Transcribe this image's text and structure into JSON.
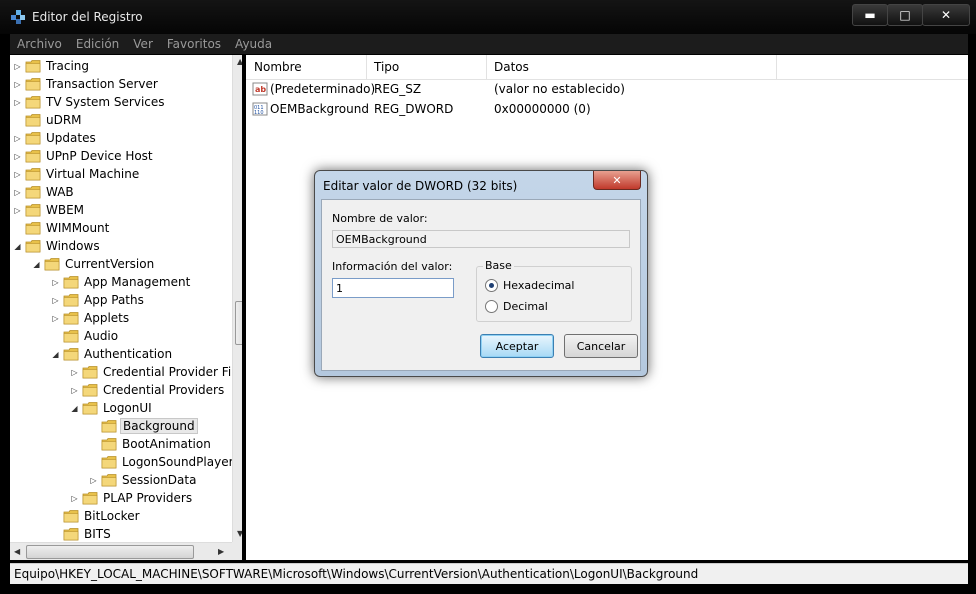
{
  "window": {
    "title": "Editor del Registro"
  },
  "menu": [
    "Archivo",
    "Edición",
    "Ver",
    "Favoritos",
    "Ayuda"
  ],
  "tree": [
    {
      "label": "Tracing",
      "level": 0,
      "exp": "closed"
    },
    {
      "label": "Transaction Server",
      "level": 0,
      "exp": "closed"
    },
    {
      "label": "TV System Services",
      "level": 0,
      "exp": "closed"
    },
    {
      "label": "uDRM",
      "level": 0,
      "exp": "none"
    },
    {
      "label": "Updates",
      "level": 0,
      "exp": "closed"
    },
    {
      "label": "UPnP Device Host",
      "level": 0,
      "exp": "closed"
    },
    {
      "label": "Virtual Machine",
      "level": 0,
      "exp": "closed"
    },
    {
      "label": "WAB",
      "level": 0,
      "exp": "closed"
    },
    {
      "label": "WBEM",
      "level": 0,
      "exp": "closed"
    },
    {
      "label": "WIMMount",
      "level": 0,
      "exp": "none"
    },
    {
      "label": "Windows",
      "level": 0,
      "exp": "open"
    },
    {
      "label": "CurrentVersion",
      "level": 1,
      "exp": "open"
    },
    {
      "label": "App Management",
      "level": 2,
      "exp": "closed"
    },
    {
      "label": "App Paths",
      "level": 2,
      "exp": "closed"
    },
    {
      "label": "Applets",
      "level": 2,
      "exp": "closed"
    },
    {
      "label": "Audio",
      "level": 2,
      "exp": "none"
    },
    {
      "label": "Authentication",
      "level": 2,
      "exp": "open"
    },
    {
      "label": "Credential Provider Fil",
      "level": 3,
      "exp": "closed"
    },
    {
      "label": "Credential Providers",
      "level": 3,
      "exp": "closed"
    },
    {
      "label": "LogonUI",
      "level": 3,
      "exp": "open"
    },
    {
      "label": "Background",
      "level": 4,
      "exp": "none",
      "selected": true
    },
    {
      "label": "BootAnimation",
      "level": 4,
      "exp": "none"
    },
    {
      "label": "LogonSoundPlayer",
      "level": 4,
      "exp": "none"
    },
    {
      "label": "SessionData",
      "level": 4,
      "exp": "closed"
    },
    {
      "label": "PLAP Providers",
      "level": 3,
      "exp": "closed"
    },
    {
      "label": "BitLocker",
      "level": 2,
      "exp": "none"
    },
    {
      "label": "BITS",
      "level": 2,
      "exp": "none"
    }
  ],
  "list": {
    "columns": [
      "Nombre",
      "Tipo",
      "Datos"
    ],
    "rows": [
      {
        "icon": "string-value-icon",
        "name": "(Predeterminado)",
        "type": "REG_SZ",
        "data": "(valor no establecido)"
      },
      {
        "icon": "binary-value-icon",
        "name": "OEMBackground",
        "type": "REG_DWORD",
        "data": "0x00000000 (0)"
      }
    ]
  },
  "status": "Equipo\\HKEY_LOCAL_MACHINE\\SOFTWARE\\Microsoft\\Windows\\CurrentVersion\\Authentication\\LogonUI\\Background",
  "dialog": {
    "title": "Editar valor de DWORD (32 bits)",
    "value_name_label": "Nombre de valor:",
    "value_name": "OEMBackground",
    "value_data_label": "Información del valor:",
    "value_data": "1",
    "base_label": "Base",
    "radio_hex": "Hexadecimal",
    "radio_dec": "Decimal",
    "ok": "Aceptar",
    "cancel": "Cancelar"
  },
  "colors": {
    "selection": "#e8e8e8",
    "folder": "#e8c14a",
    "dialog_frame": "#b4c8de"
  }
}
